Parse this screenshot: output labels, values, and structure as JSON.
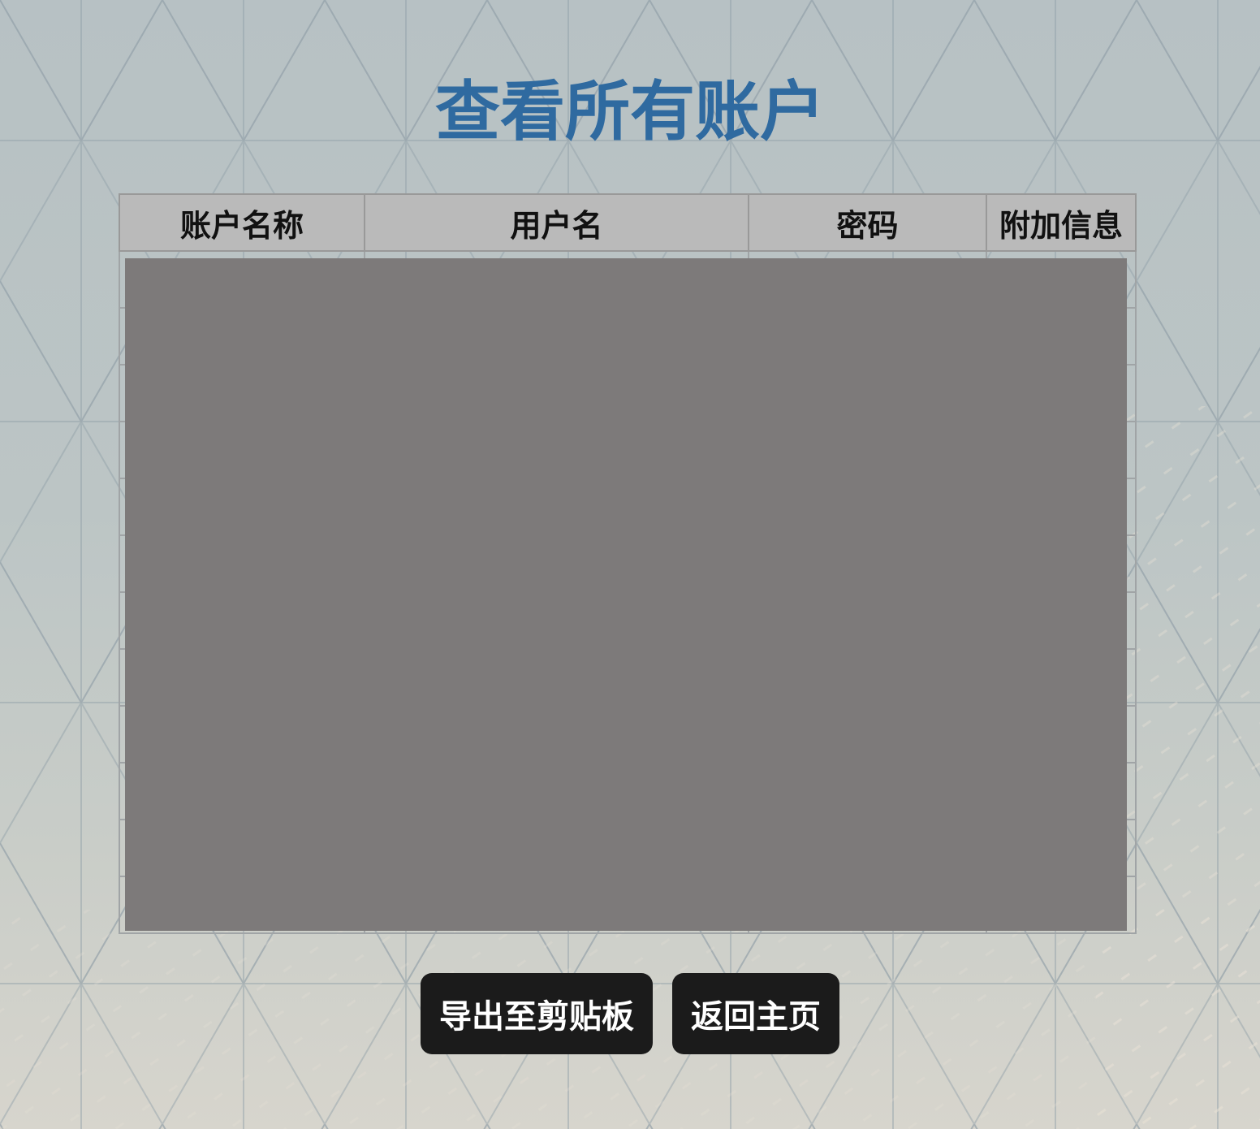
{
  "page": {
    "title": "查看所有账户"
  },
  "table": {
    "headers": [
      "账户名称",
      "用户名",
      "密码",
      "附加信息"
    ]
  },
  "actions": {
    "export_label": "导出至剪贴板",
    "home_label": "返回主页"
  },
  "colors": {
    "title": "#2f6aa0",
    "button_bg": "#1b1b1b",
    "header_bg": "#bababa",
    "overlay": "#7d7a7a"
  }
}
